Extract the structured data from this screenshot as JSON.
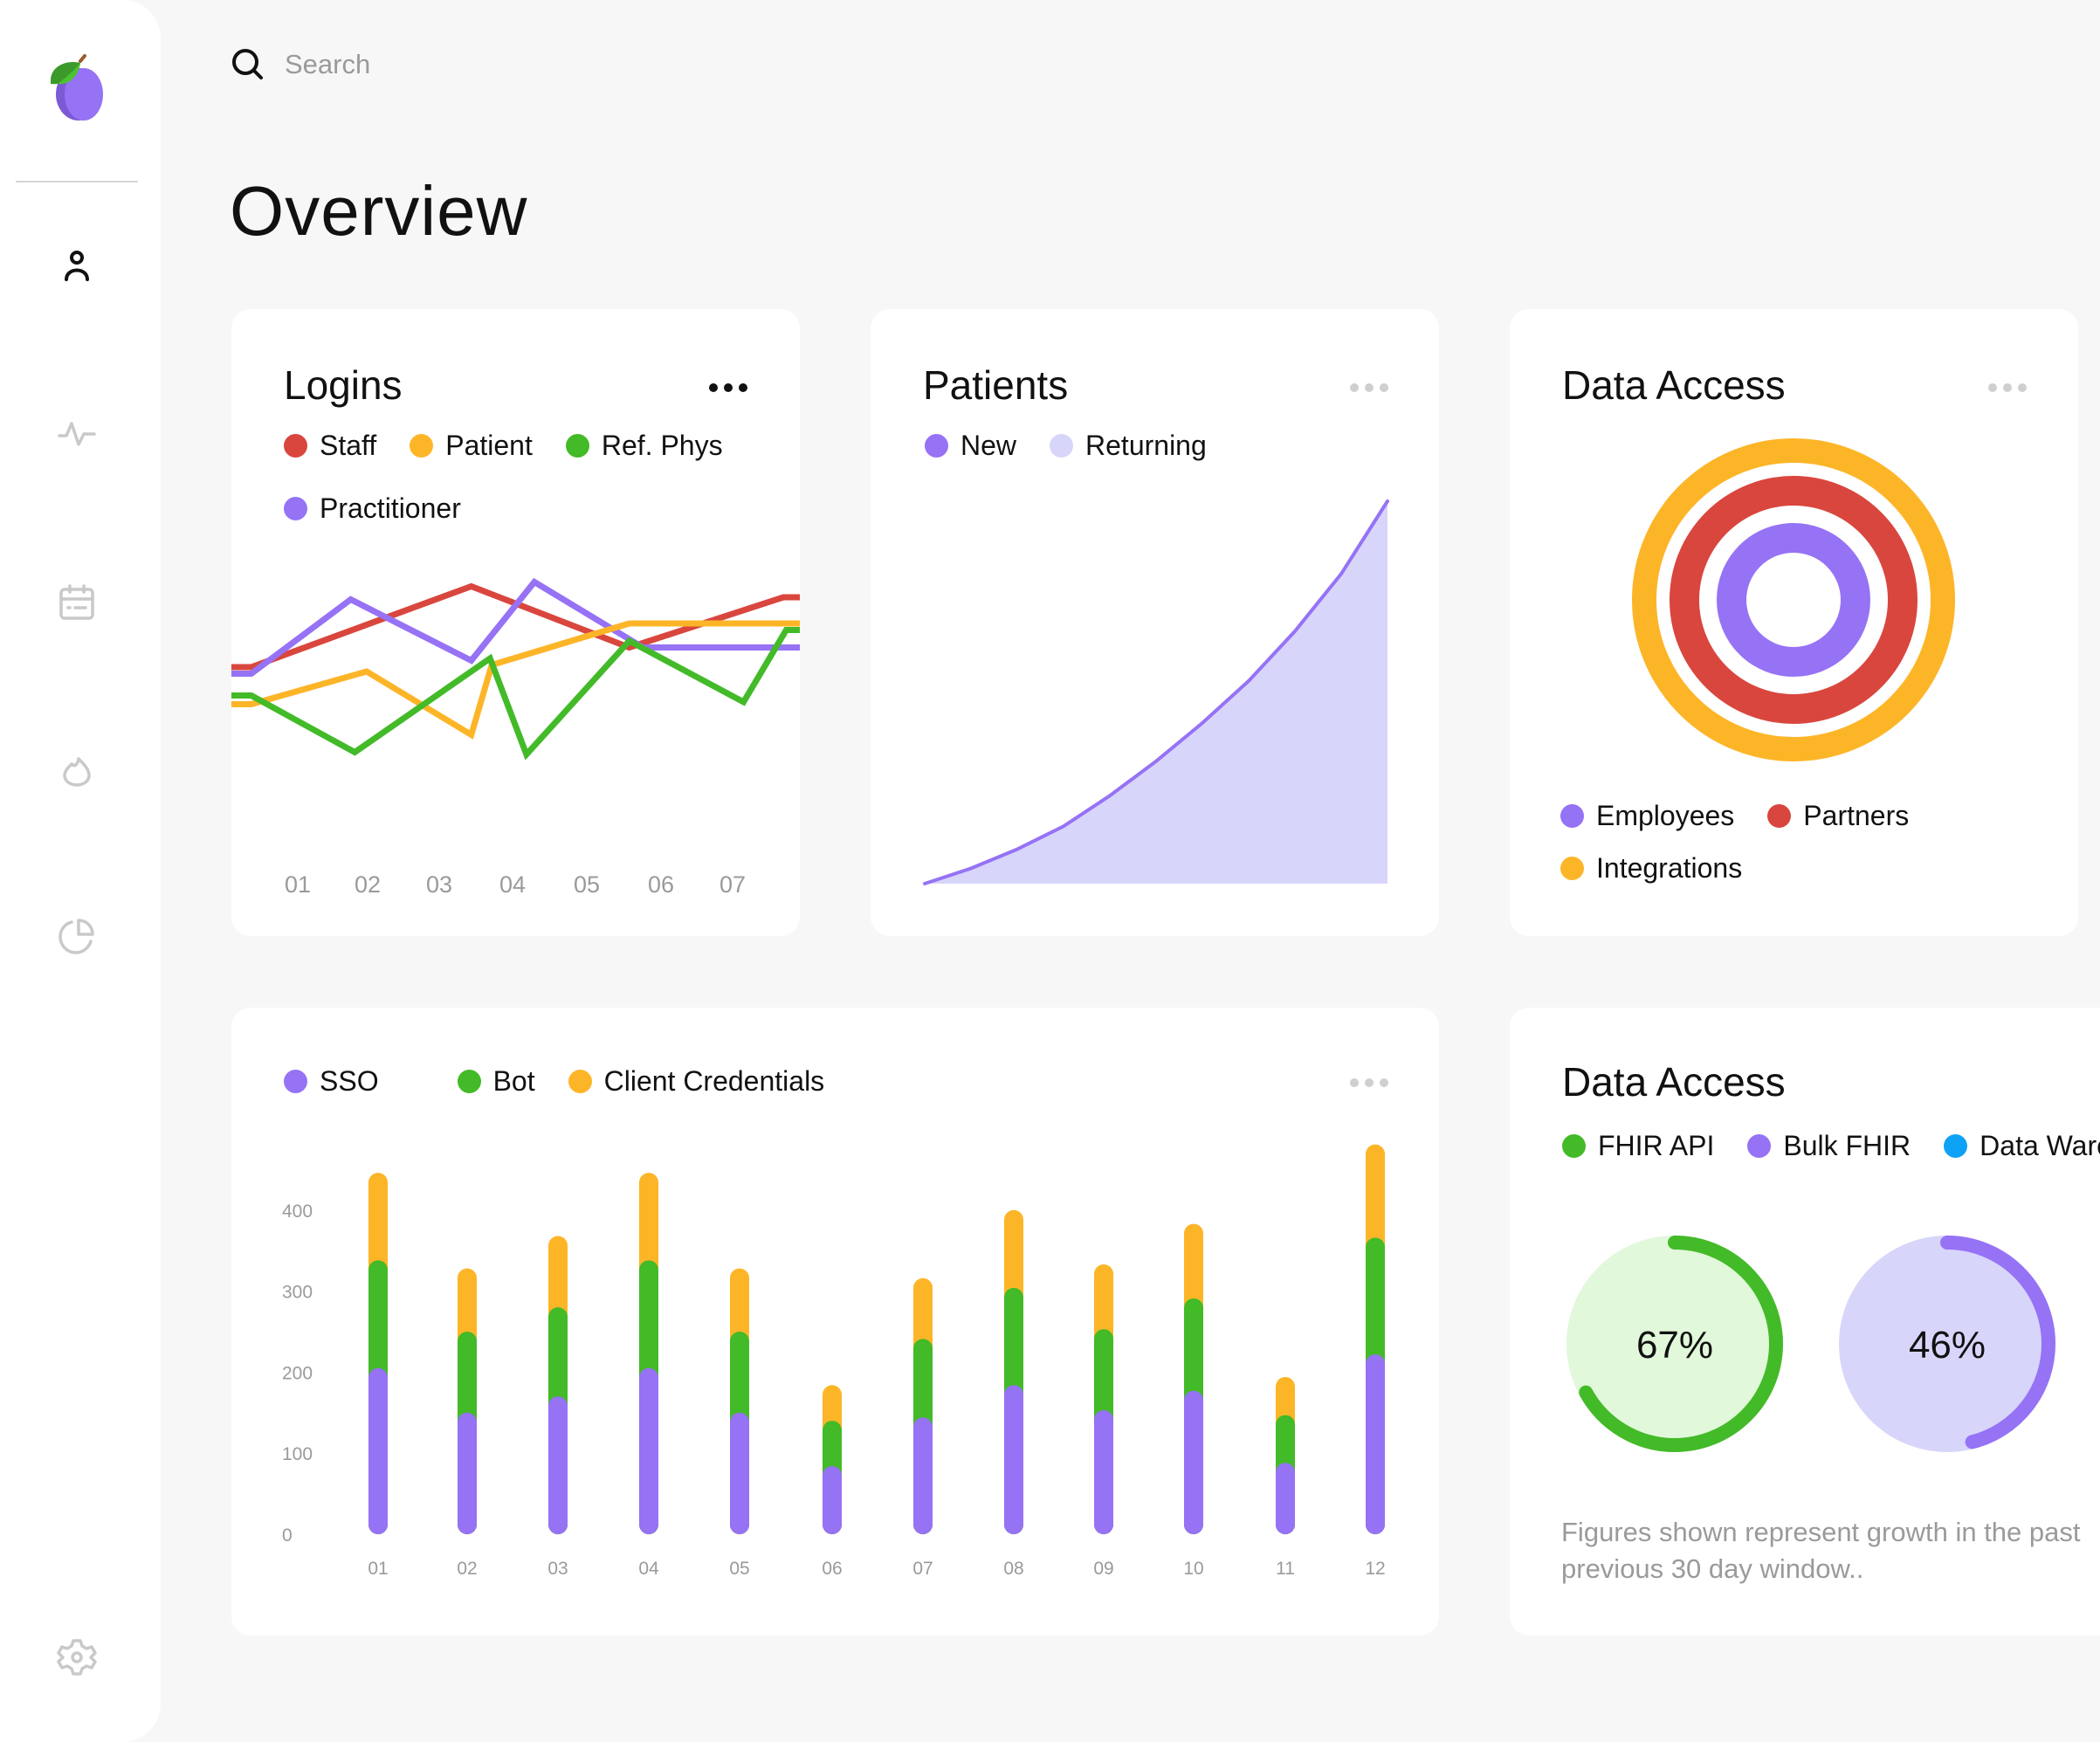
{
  "colors": {
    "purple": "#9672f5",
    "red": "#d9463e",
    "yellow": "#fdb528",
    "green": "#43ba28",
    "blue": "#0ea2f7",
    "lavender": "#d8d5fb",
    "mint": "#e1f8da",
    "muted": "#9a9a9a"
  },
  "sidebar": {
    "logo": "plum-logo",
    "items": [
      {
        "name": "users",
        "icon": "user-icon",
        "active": true
      },
      {
        "name": "activity",
        "icon": "activity-icon",
        "active": false
      },
      {
        "name": "calendar",
        "icon": "calendar-icon",
        "active": false
      },
      {
        "name": "trending",
        "icon": "flame-icon",
        "active": false
      },
      {
        "name": "reports",
        "icon": "pie-chart-icon",
        "active": false
      }
    ],
    "settings": {
      "name": "settings",
      "icon": "gear-icon"
    }
  },
  "header": {
    "search_placeholder": "Search",
    "search_value": "",
    "page_title": "Overview"
  },
  "cards": {
    "logins": {
      "title": "Logins",
      "legend": [
        {
          "label": "Staff",
          "color": "#d9463e"
        },
        {
          "label": "Patient",
          "color": "#fdb528"
        },
        {
          "label": "Ref. Phys",
          "color": "#43ba28"
        },
        {
          "label": "Practitioner",
          "color": "#9672f5"
        }
      ]
    },
    "patients": {
      "title": "Patients",
      "legend": [
        {
          "label": "New",
          "color": "#9672f5"
        },
        {
          "label": "Returning",
          "color": "#d8d5fb"
        }
      ]
    },
    "data_access_rings": {
      "title": "Data Access",
      "legend": [
        {
          "label": "Employees",
          "color": "#9672f5"
        },
        {
          "label": "Partners",
          "color": "#d9463e"
        },
        {
          "label": "Integrations",
          "color": "#fdb528"
        }
      ]
    },
    "auth_bars": {
      "legend": [
        {
          "label": "SSO",
          "color": "#9672f5"
        },
        {
          "label": "Bot",
          "color": "#43ba28"
        },
        {
          "label": "Client Credentials",
          "color": "#fdb528"
        }
      ]
    },
    "data_access_gauges": {
      "title": "Data Access",
      "legend": [
        {
          "label": "FHIR API",
          "color": "#43ba28"
        },
        {
          "label": "Bulk FHIR",
          "color": "#9672f5"
        },
        {
          "label": "Data Warehouse",
          "color": "#0ea2f7"
        }
      ],
      "footnote_line1": "Figures shown represent growth in the past",
      "footnote_line2": "previous 30 day window.."
    }
  },
  "chart_data": [
    {
      "id": "logins",
      "type": "line",
      "title": "Logins",
      "xlabel": "",
      "ylabel": "",
      "x_ticks": [
        "01",
        "02",
        "03",
        "04",
        "05",
        "06",
        "07"
      ],
      "x_range": [
        0,
        1
      ],
      "ylim": [
        0,
        100
      ],
      "grid": false,
      "legend_position": "top-left",
      "series": [
        {
          "name": "Staff",
          "color": "#d9463e",
          "x": [
            0,
            0.035,
            0.422,
            0.7,
            0.971,
            1
          ],
          "y": [
            48,
            48,
            85,
            57,
            80,
            80
          ]
        },
        {
          "name": "Practitioner",
          "color": "#9672f5",
          "x": [
            0,
            0.035,
            0.21,
            0.422,
            0.533,
            0.724,
            1
          ],
          "y": [
            45,
            45,
            79,
            51,
            87,
            57,
            57
          ]
        },
        {
          "name": "Patient",
          "color": "#fdb528",
          "x": [
            0,
            0.035,
            0.238,
            0.422,
            0.458,
            0.7,
            1
          ],
          "y": [
            31,
            31,
            46,
            17,
            49,
            68,
            68
          ]
        },
        {
          "name": "Ref. Phys",
          "color": "#43ba28",
          "x": [
            0,
            0.035,
            0.217,
            0.455,
            0.519,
            0.7,
            0.901,
            0.976,
            1
          ],
          "y": [
            35,
            35,
            9,
            52,
            8,
            60,
            32,
            65,
            65
          ]
        }
      ]
    },
    {
      "id": "patients",
      "type": "area",
      "title": "Patients",
      "xlabel": "",
      "ylabel": "",
      "x_range": [
        0,
        1
      ],
      "ylim": [
        0,
        100
      ],
      "grid": false,
      "legend_position": "top-left",
      "series": [
        {
          "name": "New",
          "color": "#9672f5",
          "role": "line",
          "x": [
            0,
            0.1,
            0.2,
            0.3,
            0.4,
            0.5,
            0.6,
            0.7,
            0.8,
            0.9,
            1.0
          ],
          "y": [
            0,
            4,
            9,
            15,
            23,
            32,
            42,
            53,
            66,
            81,
            100
          ]
        },
        {
          "name": "Returning",
          "color": "#d8d5fb",
          "role": "fill",
          "x": [
            0,
            0.1,
            0.2,
            0.3,
            0.4,
            0.5,
            0.6,
            0.7,
            0.8,
            0.9,
            1.0
          ],
          "y": [
            0,
            4,
            9,
            15,
            23,
            32,
            42,
            53,
            66,
            81,
            100
          ]
        }
      ]
    },
    {
      "id": "data_access_rings",
      "type": "pie",
      "subtype": "concentric-rings",
      "title": "Data Access",
      "legend_position": "bottom",
      "series": [
        {
          "name": "Employees",
          "color": "#9672f5",
          "fraction": 1.0,
          "ring": "inner"
        },
        {
          "name": "Partners",
          "color": "#d9463e",
          "fraction": 1.0,
          "ring": "middle"
        },
        {
          "name": "Integrations",
          "color": "#fdb528",
          "fraction": 1.0,
          "ring": "outer"
        }
      ]
    },
    {
      "id": "auth_bars",
      "type": "bar",
      "subtype": "stacked",
      "title": "",
      "xlabel": "",
      "ylabel": "",
      "categories": [
        "01",
        "02",
        "03",
        "04",
        "05",
        "06",
        "07",
        "08",
        "09",
        "10",
        "11",
        "12"
      ],
      "y_ticks": [
        0,
        100,
        200,
        300,
        400
      ],
      "ylim": [
        0,
        480
      ],
      "grid": false,
      "legend_position": "top-left",
      "series": [
        {
          "name": "SSO",
          "color": "#9672f5",
          "values": [
            205,
            150,
            170,
            205,
            150,
            84,
            144,
            184,
            153,
            177,
            88,
            222
          ]
        },
        {
          "name": "Bot",
          "color": "#43ba28",
          "values": [
            133,
            100,
            110,
            133,
            100,
            56,
            97,
            120,
            100,
            114,
            59,
            144
          ]
        },
        {
          "name": "Client Credentials",
          "color": "#fdb528",
          "values": [
            108,
            78,
            88,
            108,
            78,
            44,
            75,
            96,
            80,
            92,
            47,
            115
          ]
        }
      ]
    },
    {
      "id": "data_access_gauges",
      "type": "pie",
      "subtype": "radial-gauge",
      "title": "Data Access",
      "legend_position": "top-left",
      "series": [
        {
          "name": "FHIR API",
          "value": 67,
          "label": "67%",
          "color": "#43ba28",
          "track": "#e1f8da"
        },
        {
          "name": "Bulk FHIR",
          "value": 46,
          "label": "46%",
          "color": "#9672f5",
          "track": "#d8d5fb"
        }
      ]
    }
  ]
}
